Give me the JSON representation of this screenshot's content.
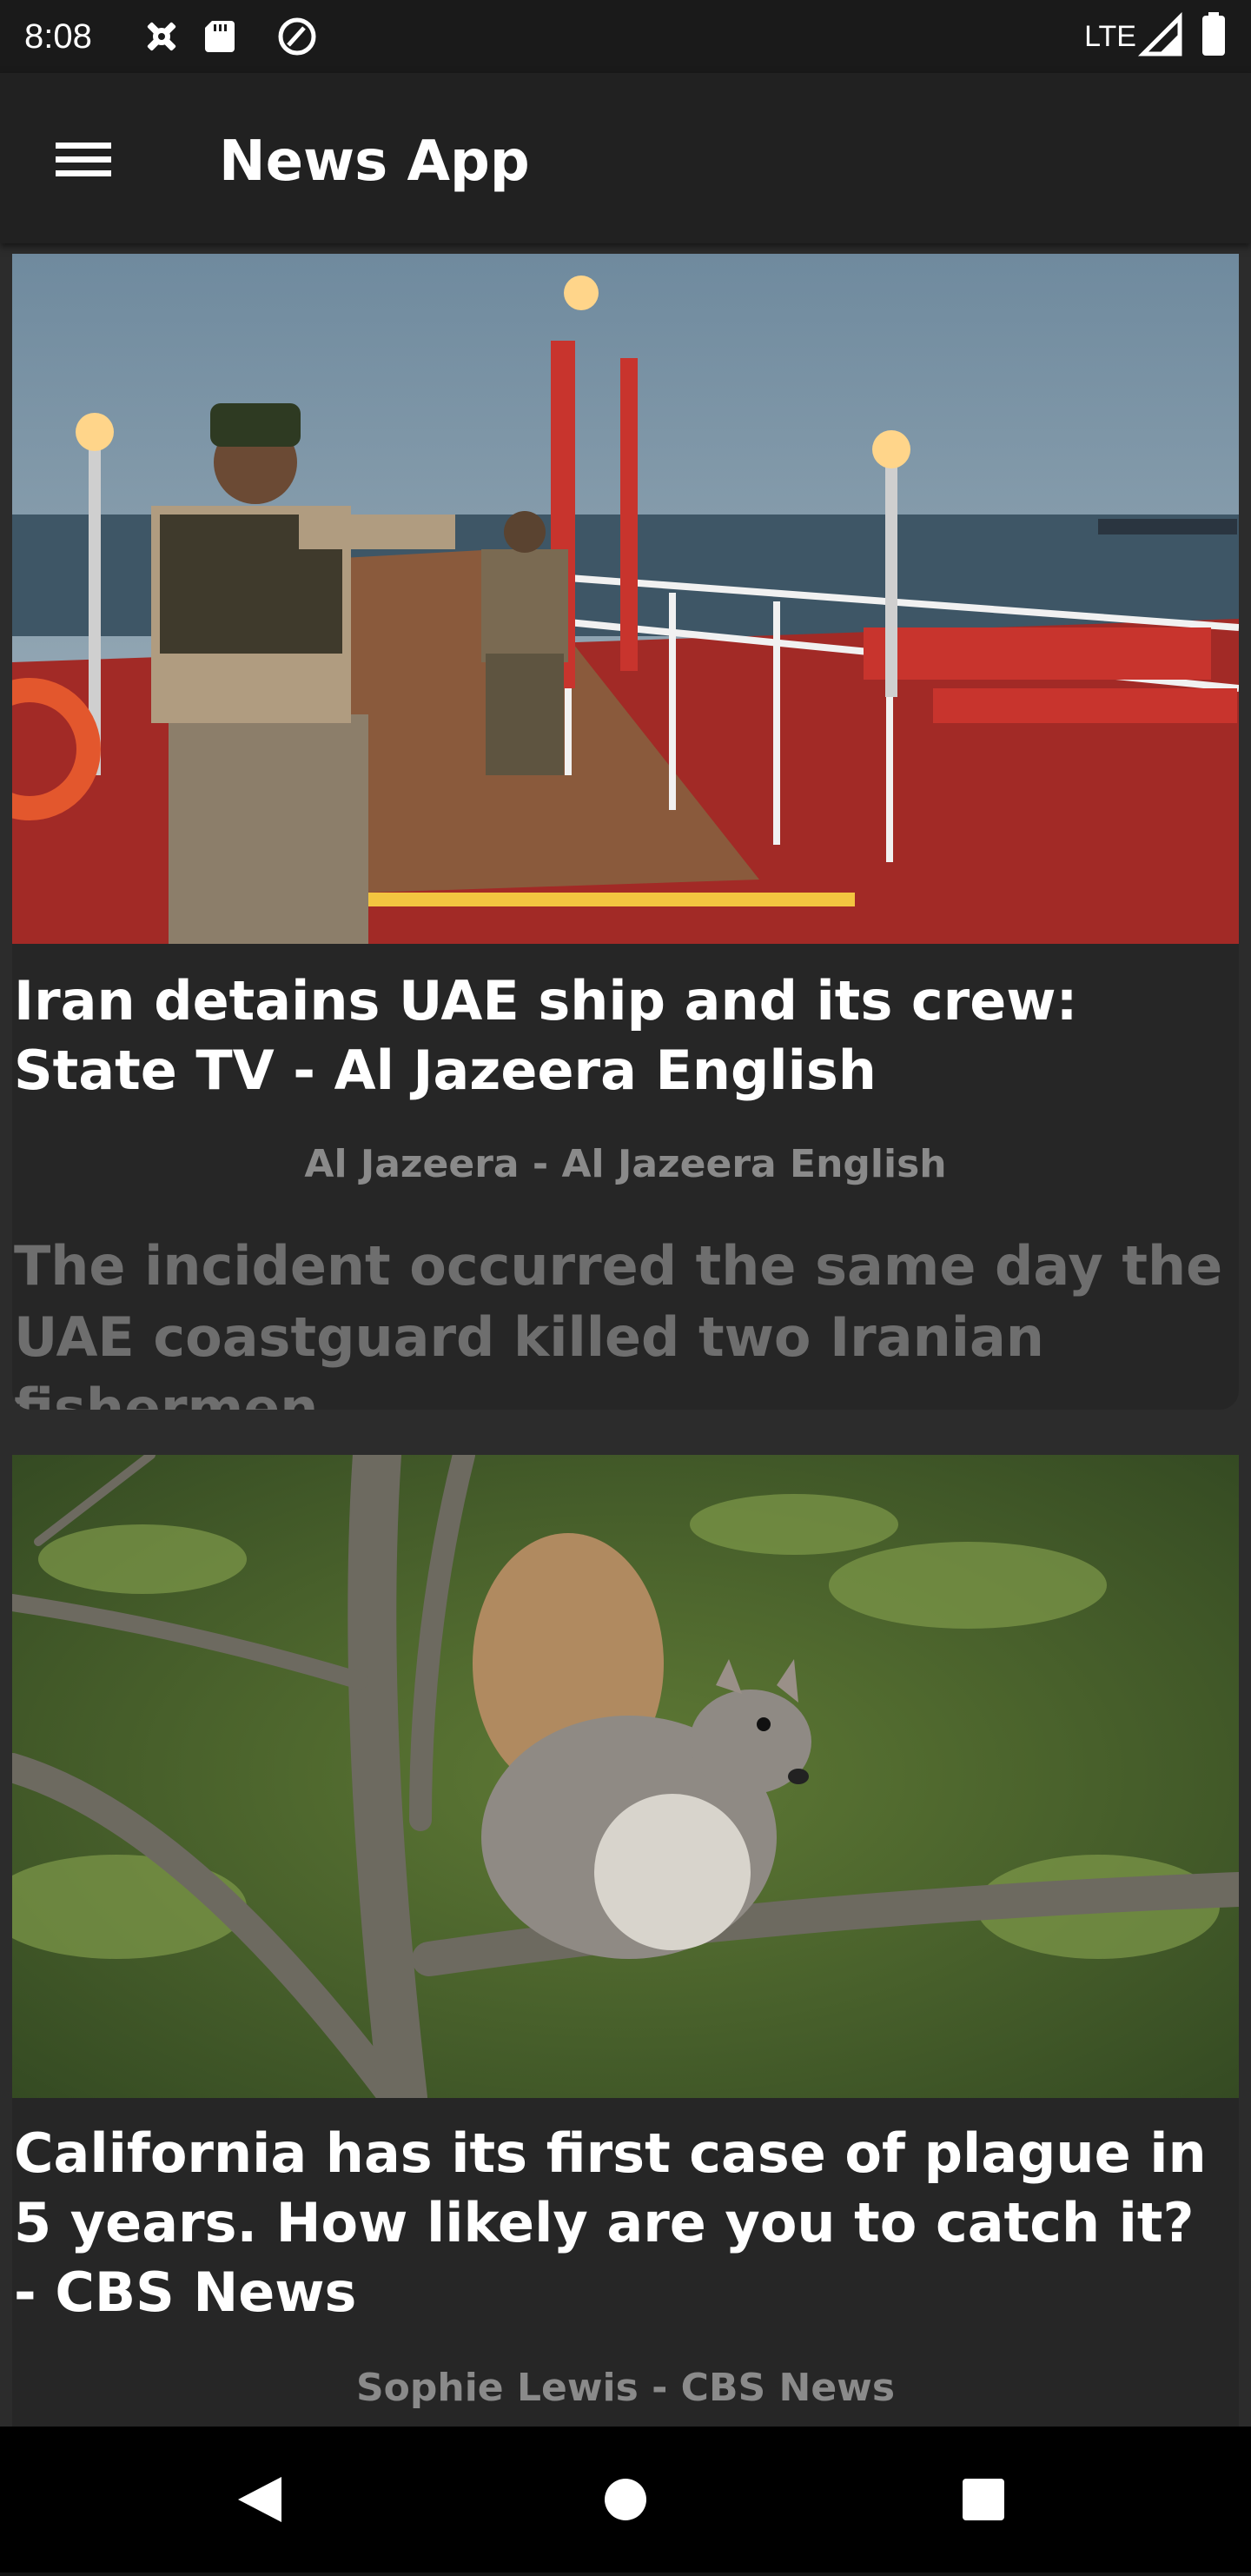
{
  "status_bar": {
    "time": "8:08",
    "network": "LTE"
  },
  "app_bar": {
    "title": "News App",
    "menu_icon": "hamburger-menu-icon"
  },
  "articles": [
    {
      "headline": "Iran detains UAE ship and its crew: State TV - Al Jazeera English",
      "source": "Al Jazeera - Al Jazeera English",
      "description": "The incident occurred the same day the UAE coastguard killed two Iranian fishermen."
    },
    {
      "headline": "California has its first case of plague in 5 years. How likely are you to catch it? - CBS News",
      "source": "Sophie Lewis - CBS News",
      "description": ""
    }
  ],
  "nav_bar": {
    "back_icon": "back-triangle-icon",
    "home_icon": "home-circle-icon",
    "recents_icon": "recents-square-icon"
  }
}
